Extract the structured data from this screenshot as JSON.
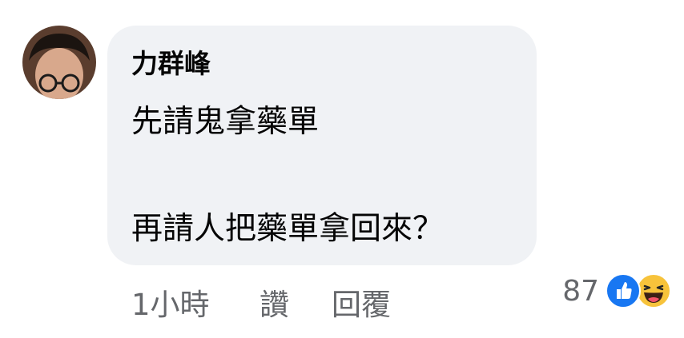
{
  "comment": {
    "author": "力群峰",
    "lines": [
      "先請鬼拿藥單",
      "再請人把藥單拿回來？"
    ]
  },
  "actions": {
    "time": "1小時",
    "like_label": "讚",
    "reply_label": "回覆"
  },
  "reactions": {
    "count": "87",
    "icons": [
      "like-icon",
      "haha-icon"
    ],
    "colors": {
      "like": "#1877f2",
      "haha": "#f7c33b"
    }
  }
}
